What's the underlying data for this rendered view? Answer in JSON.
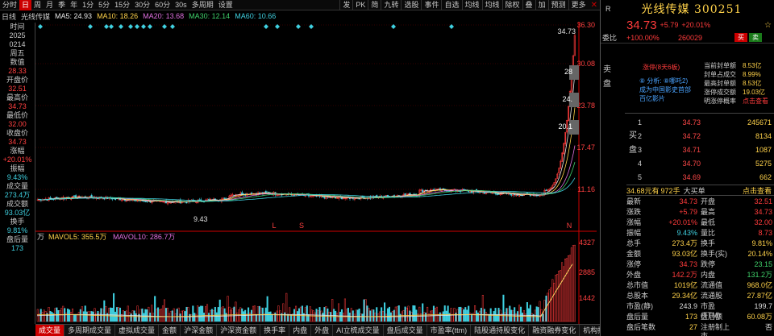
{
  "toolbar": {
    "left_items": [
      "分时",
      "日",
      "周",
      "月",
      "季",
      "年",
      "1分",
      "5分",
      "15分",
      "30分",
      "60分",
      "30s",
      "多周期",
      "设置"
    ],
    "selected": "日",
    "right_items": [
      "发",
      "PK",
      "简",
      "九转",
      "选股",
      "事件",
      "自选",
      "均线",
      "均线",
      "除权",
      "叠",
      "加",
      "预测",
      "更多"
    ]
  },
  "ma_line": [
    {
      "text": "日线",
      "color": "#c8c8c8"
    },
    {
      "text": "光线传媒",
      "color": "#c8c8c8"
    },
    {
      "text": "MA5: 24.93",
      "color": "#e8e8e8"
    },
    {
      "text": "MA10: 18.26",
      "color": "#ffd24a"
    },
    {
      "text": "MA20: 13.68",
      "color": "#e070e0"
    },
    {
      "text": "MA30: 12.14",
      "color": "#3fd06a"
    },
    {
      "text": "MA60: 10.66",
      "color": "#3fd0e0"
    }
  ],
  "left_panel": [
    {
      "k": "时间",
      "v": "2025"
    },
    {
      "k": "",
      "v": "0214"
    },
    {
      "k": "周五",
      "v": ""
    },
    {
      "k": "数值",
      "v": "28.33"
    },
    {
      "k": "开盘价",
      "v": "32.51"
    },
    {
      "k": "最高价",
      "v": "34.73"
    },
    {
      "k": "最低价",
      "v": "32.00"
    },
    {
      "k": "收盘价",
      "v": "34.73"
    },
    {
      "k": "涨幅",
      "v": "+20.01%"
    },
    {
      "k": "振幅",
      "v": "9.43%"
    },
    {
      "k": "成交量",
      "v": "273.4万"
    },
    {
      "k": "成交额",
      "v": "93.03亿"
    },
    {
      "k": "换手",
      "v": "9.81%"
    },
    {
      "k": "盘后量",
      "v": "173"
    }
  ],
  "price_axis": [
    "36.30",
    "30.08",
    "23.78",
    "17.47",
    "11.16"
  ],
  "vol_axis": [
    "4327",
    "2885",
    "1442"
  ],
  "high_label": "34.73",
  "low_label": "9.43",
  "price_tags": [
    "28",
    "24.",
    "20.1"
  ],
  "markers": {
    "l": "L",
    "s": "S",
    "n": "N",
    "r": "R"
  },
  "vol_label": {
    "unit": "万",
    "mavol5": "MAVOL5: 355.5万",
    "mavol10": "MAVOL10: 286.7万"
  },
  "tabs": [
    "成交量",
    "多周期成交量",
    "虚拟成交量",
    "金额",
    "沪深金额",
    "沪深资金额",
    "换手率",
    "内盘",
    "外盘",
    "AI立梳成交量",
    "盘后成交量",
    "市盈率(ttm)",
    "陆股通持股变化",
    "融资融券变化",
    "机构探明显"
  ],
  "tab_selected": "成交量",
  "right": {
    "code_prefix": "R",
    "name": "光线传媒 300251",
    "price": "34.73",
    "change": "+5.79",
    "pct": "+20.01%",
    "wb_label": "委比",
    "wb_pct": "+100.00%",
    "wb_diff": "260029",
    "buy": "买",
    "sell": "卖",
    "sell_side_label": "卖盘",
    "news_title": "涨停(8天6板)",
    "news_lines": [
      "⑧ 分析: ⑧哪吒2)",
      "成为中国影史首部",
      "百亿影片"
    ],
    "seal": [
      {
        "k": "当前封单额",
        "v": "8.53亿"
      },
      {
        "k": "封单占成交",
        "v": "8.99%"
      },
      {
        "k": "最高封单额",
        "v": "8.53亿"
      },
      {
        "k": "涨停成交额",
        "v": "19.03亿"
      },
      {
        "k": "明涨停概率",
        "v": "点击查看"
      }
    ],
    "buy_side_label": "买盘",
    "bids": [
      {
        "i": "1",
        "p": "34.73",
        "v": "245671"
      },
      {
        "i": "2",
        "p": "34.72",
        "v": "8134"
      },
      {
        "i": "3",
        "p": "34.71",
        "v": "1087"
      },
      {
        "i": "4",
        "p": "34.70",
        "v": "5275"
      },
      {
        "i": "5",
        "p": "34.69",
        "v": "662"
      }
    ],
    "summary": {
      "a": "34.68元有",
      "b": "972手",
      "c": "大买单",
      "d": "点击查看"
    },
    "quote": [
      {
        "k1": "最新",
        "v1": "34.73",
        "c1": "red",
        "k2": "开盘",
        "v2": "32.51",
        "c2": "red"
      },
      {
        "k1": "涨跌",
        "v1": "+5.79",
        "c1": "red",
        "k2": "最高",
        "v2": "34.73",
        "c2": "red"
      },
      {
        "k1": "涨幅",
        "v1": "+20.01%",
        "c1": "red",
        "k2": "最低",
        "v2": "32.00",
        "c2": "red"
      },
      {
        "k1": "振幅",
        "v1": "9.43%",
        "c1": "cy",
        "k2": "量比",
        "v2": "8.73",
        "c2": "red"
      },
      {
        "k1": "总手",
        "v1": "273.4万",
        "c1": "yel",
        "k2": "换手",
        "v2": "9.81%",
        "c2": "yel"
      },
      {
        "k1": "金额",
        "v1": "93.03亿",
        "c1": "yel",
        "k2": "换手(实)",
        "v2": "20.14%",
        "c2": "yel"
      },
      {
        "k1": "涨停",
        "v1": "34.73",
        "c1": "red",
        "k2": "跌停",
        "v2": "23.15",
        "c2": "grn"
      },
      {
        "k1": "外盘",
        "v1": "142.2万",
        "c1": "red",
        "k2": "内盘",
        "v2": "131.2万",
        "c2": "grn"
      },
      {
        "k1": "总市值",
        "v1": "1019亿",
        "c1": "yel",
        "k2": "流通值",
        "v2": "968.0亿",
        "c2": "yel"
      },
      {
        "k1": "总股本",
        "v1": "29.34亿",
        "c1": "yel",
        "k2": "流通股",
        "v2": "27.87亿",
        "c2": "yel"
      },
      {
        "k1": "市盈(静)",
        "v1": "243.9",
        "c1": "wh",
        "k2": "市盈(TTM)",
        "v2": "199.7",
        "c2": "wh"
      },
      {
        "k1": "盘后量",
        "v1": "173",
        "c1": "yel",
        "k2": "盘后额",
        "v2": "60.08万",
        "c2": "yel"
      },
      {
        "k1": "盘后笔数",
        "v1": "27",
        "c1": "yel",
        "k2": "注册制上市",
        "v2": "否",
        "c2": "wh"
      }
    ]
  },
  "colors": {
    "up": "#ff3b3b",
    "down": "#3fd0e0",
    "ma5": "#e8e8e8",
    "ma10": "#ffd24a",
    "ma20": "#e070e0",
    "ma30": "#3fd06a",
    "ma60": "#3fd0e0"
  }
}
